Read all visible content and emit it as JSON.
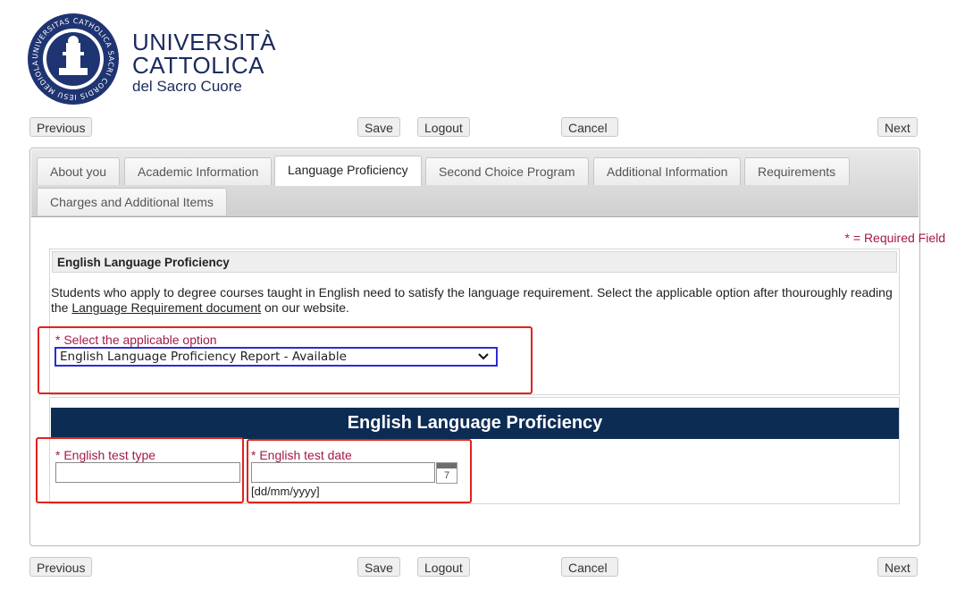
{
  "logo": {
    "seal_text": "UNIVERSITAS CATHOLICA SACRI CORDIS IESU MEDIOLANI",
    "line1": "UNIVERSITÀ",
    "line2": "CATTOLICA",
    "line3": "del Sacro Cuore"
  },
  "nav": {
    "previous": "Previous",
    "save": "Save",
    "logout": "Logout",
    "cancel": "Cancel",
    "next": "Next"
  },
  "tabs": [
    {
      "label": "About you"
    },
    {
      "label": "Academic Information"
    },
    {
      "label": "Language Proficiency",
      "active": true
    },
    {
      "label": "Second Choice Program"
    },
    {
      "label": "Additional Information"
    },
    {
      "label": "Requirements"
    },
    {
      "label": "Charges and Additional Items"
    }
  ],
  "required_note": "* = Required Field",
  "section": {
    "title": "English Language Proficiency",
    "desc_before": "Students who apply to degree courses taught in English need to satisfy the language requirement. Select the applicable option after thouroughly reading the ",
    "desc_link": "Language Requirement document",
    "desc_after": " on our website.",
    "select_label": "* Select the applicable option",
    "select_value": "English Language Proficiency Report - Available"
  },
  "banner": "English Language Proficiency",
  "fields": {
    "test_type_label": "* English test type",
    "test_type_value": "",
    "test_date_label": "* English test date",
    "test_date_value": "",
    "date_format": "[dd/mm/yyyy]",
    "calendar_day": "7"
  },
  "colors": {
    "accent": "#a3194a",
    "banner_bg": "#0d2c54",
    "highlight_red": "#e0231d",
    "select_border": "#2b2bd6"
  }
}
